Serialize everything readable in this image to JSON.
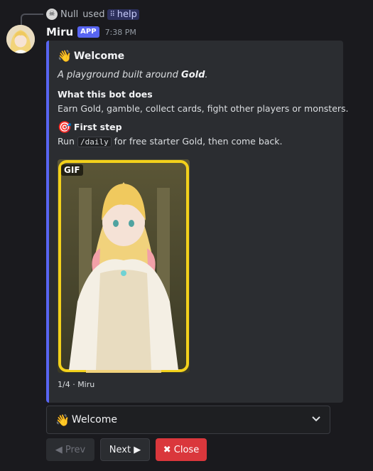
{
  "reply": {
    "user": "Null",
    "used_text": "used",
    "command": "help",
    "command_icon": "grid-icon",
    "avatar_icon": "skull-icon"
  },
  "message": {
    "username": "Miru",
    "app_tag": "APP",
    "timestamp": "7:38 PM",
    "avatar_icon": "anime-girl-avatar"
  },
  "embed": {
    "accent_color": "#5865f2",
    "title_emoji": "👋",
    "title": "Welcome",
    "description_prefix": "A playground built around ",
    "description_bold": "Gold",
    "description_suffix": ".",
    "field1_name": "What this bot does",
    "field1_value": "Earn Gold, gamble, collect cards, fight other players or monsters.",
    "field2_emoji": "🎯",
    "field2_name": "First step",
    "field2_run": "Run ",
    "field2_code": "/daily",
    "field2_rest": " for free starter Gold, then come back.",
    "image_badge": "GIF",
    "footer": "1/4 · Miru"
  },
  "select": {
    "emoji": "👋",
    "value": "Welcome",
    "icon": "chevron-down-icon"
  },
  "buttons": {
    "prev": "◀ Prev",
    "next": "Next ▶",
    "close": "✖ Close",
    "close_color": "#da373c"
  }
}
